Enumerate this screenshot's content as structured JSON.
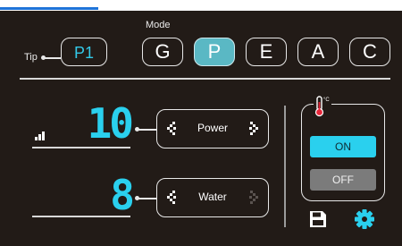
{
  "tip": {
    "label": "Tip",
    "value": "P1"
  },
  "mode": {
    "label": "Mode",
    "options": [
      "G",
      "P",
      "E",
      "A",
      "C"
    ],
    "selected": "P"
  },
  "power": {
    "label": "Power",
    "value": "10"
  },
  "water": {
    "label": "Water",
    "value": "8"
  },
  "heater": {
    "unit": "°C",
    "on_label": "ON",
    "off_label": "OFF",
    "state": "ON"
  },
  "icons": {
    "signal": "signal-bars-icon",
    "thermometer": "thermometer-icon",
    "save": "save-icon",
    "settings": "gear-icon",
    "decrease": "chevron-left-icon",
    "increase": "chevron-right-icon"
  },
  "colors": {
    "background": "#221b17",
    "accent": "#2ad0ee",
    "mode_active": "#5ab8c4",
    "off_button": "#7b7b7b",
    "top_accent": "#1e73d8"
  }
}
